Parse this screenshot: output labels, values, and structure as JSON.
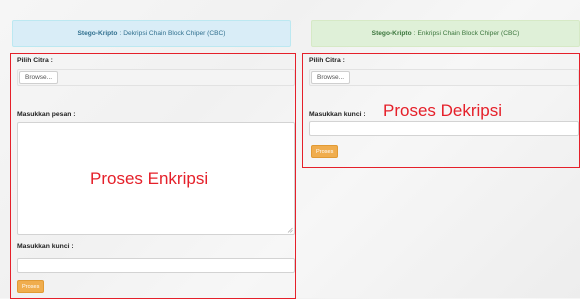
{
  "left_panel": {
    "header": {
      "brand": "Stego-Kripto",
      "separator": ":",
      "subtitle": "Dekripsi Chain Block Chiper (CBC)"
    },
    "pilih_citra_label": "Pilih Citra :",
    "browse_button": "Browse...",
    "pesan_label": "Masukkan pesan :",
    "pesan_value": "",
    "kunci_label": "Masukkan kunci :",
    "kunci_value": "",
    "proses_button": "Proses"
  },
  "right_panel": {
    "header": {
      "brand": "Stego-Kripto",
      "separator": ":",
      "subtitle": "Enkripsi Chain Block Chiper (CBC)"
    },
    "pilih_citra_label": "Pilih Citra :",
    "browse_button": "Browse...",
    "kunci_label": "Masukkan kunci :",
    "kunci_value": "",
    "proses_button": "Proses"
  },
  "annotations": {
    "enkripsi": "Proses Enkripsi",
    "dekripsi": "Proses Dekripsi"
  },
  "colors": {
    "annotation_red": "#e5202a",
    "button_orange": "#f0ad4e",
    "info_blue": "#d9edf7",
    "success_green": "#dff0d8"
  }
}
